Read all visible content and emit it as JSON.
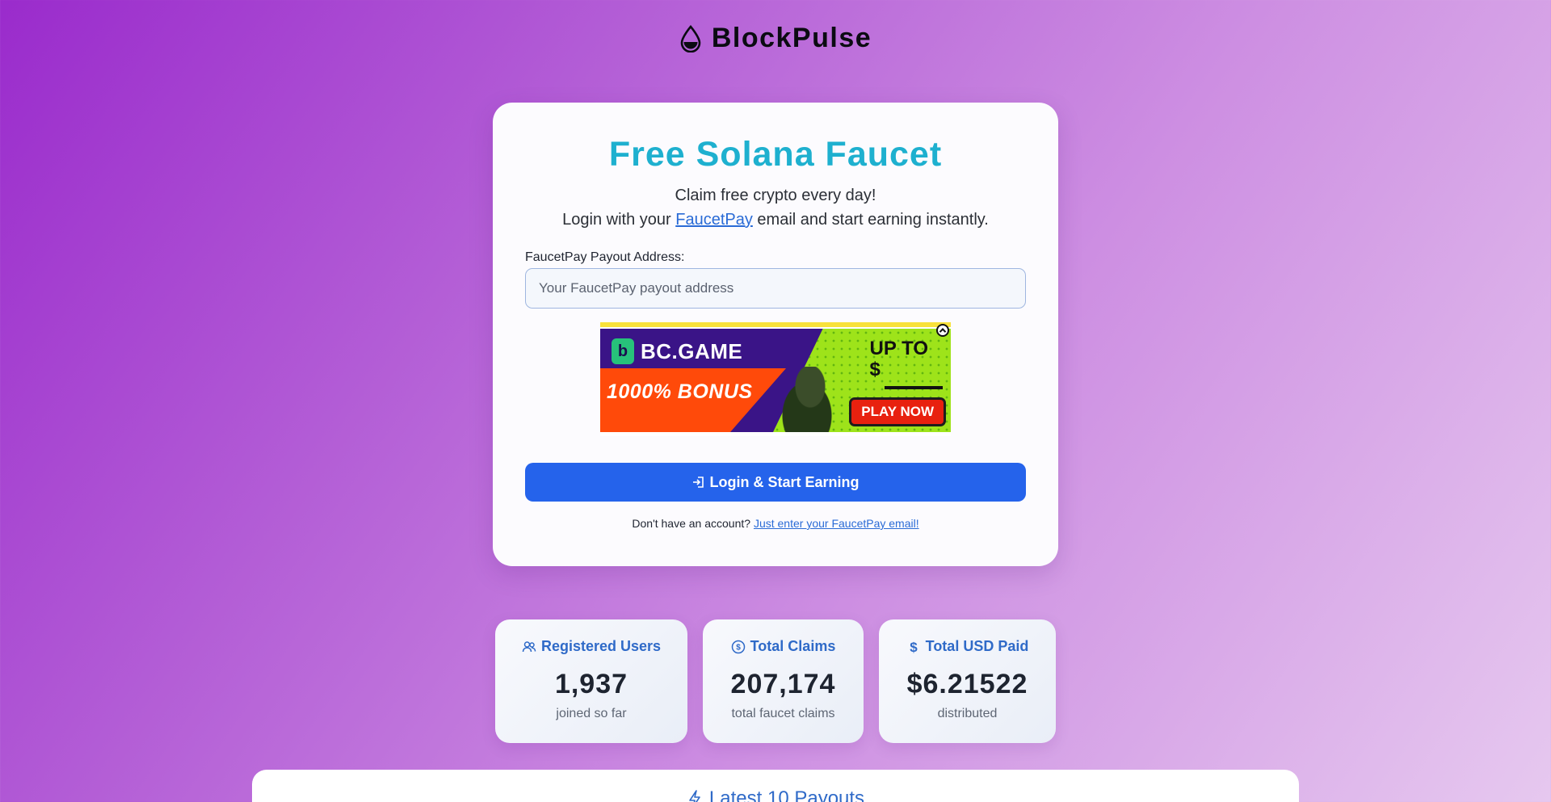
{
  "brand": {
    "name": "BlockPulse",
    "icon": "droplet-icon"
  },
  "card": {
    "title": "Free Solana Faucet",
    "subtitle_line1": "Claim free crypto every day!",
    "subtitle_line2_prefix": "Login with your",
    "subtitle_link": "FaucetPay",
    "subtitle_line2_suffix": "email and start earning instantly.",
    "field_label": "FaucetPay Payout Address:",
    "field_placeholder": "Your FaucetPay payout address",
    "field_value": "",
    "login_button": "Login & Start Earning",
    "signup_prefix": "Don't have an account?",
    "signup_link": "Just enter your FaucetPay email!"
  },
  "ad": {
    "logo_text": "BC.GAME",
    "bonus_text": "1000% BONUS",
    "upto_line1": "UP TO",
    "upto_line2": "$",
    "cta": "PLAY NOW",
    "colors": {
      "purple": "#3a1487",
      "green": "#9ee31a",
      "orange": "#ff4a0a"
    }
  },
  "stats": [
    {
      "icon": "users-icon",
      "label": "Registered Users",
      "value": "1,937",
      "note": "joined so far"
    },
    {
      "icon": "coin-icon",
      "label": "Total Claims",
      "value": "207,174",
      "note": "total faucet claims"
    },
    {
      "icon": "dollar-icon",
      "label": "Total USD Paid",
      "value": "$6.21522",
      "note": "distributed"
    }
  ],
  "payouts": {
    "icon": "lightning-icon",
    "title": "Latest 10 Payouts"
  },
  "colors": {
    "accent": "#2563eb",
    "title": "#1eb0cf",
    "stat_label": "#2f6ac8"
  }
}
